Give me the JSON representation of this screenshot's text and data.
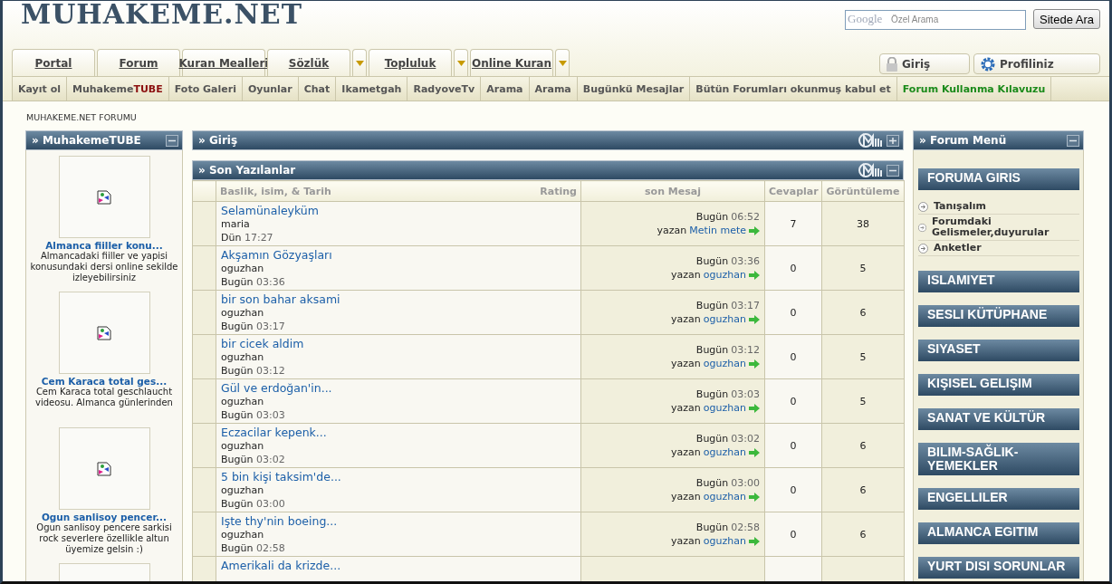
{
  "logo": {
    "text": "MUHAKEME.NET"
  },
  "search": {
    "brand": "Google",
    "placeholder": "Özel Arama",
    "button": "Sitede Ara"
  },
  "tabs": [
    {
      "label": "Portal",
      "dropdown": false
    },
    {
      "label": "Forum",
      "dropdown": false
    },
    {
      "label": "Kuran Mealleri",
      "dropdown": false
    },
    {
      "label": "Sözlük",
      "dropdown": true
    },
    {
      "label": "Topluluk",
      "dropdown": true
    },
    {
      "label": "Online Kuran",
      "dropdown": true
    }
  ],
  "user_buttons": [
    {
      "label": "Giriş"
    },
    {
      "label": "Profiliniz"
    }
  ],
  "subnav": [
    {
      "label": "Kayıt ol",
      "kind": "plain"
    },
    {
      "label": "Muhakeme",
      "accent": "TUBE",
      "kind": "accent"
    },
    {
      "label": "Foto Galeri",
      "kind": "plain"
    },
    {
      "label": "Oyunlar",
      "kind": "plain"
    },
    {
      "label": "Chat",
      "kind": "plain"
    },
    {
      "label": "Ikametgah",
      "kind": "plain"
    },
    {
      "label": "RadyoveTv",
      "kind": "plain"
    },
    {
      "label": "Arama",
      "kind": "plain"
    },
    {
      "label": "Arama",
      "kind": "plain"
    },
    {
      "label": "Bugünkü Mesajlar",
      "kind": "plain"
    },
    {
      "label": "Bütün Forumları okunmuş kabul et",
      "kind": "plain"
    },
    {
      "label": "Forum Kullanma Kılavuzu",
      "kind": "highlight"
    }
  ],
  "breadcrumb": "MUHAKEME.NET FORUMU",
  "tube": {
    "title": "» MuhakemeTUBE",
    "collapsed": false,
    "videos": [
      {
        "kind": "video",
        "title": "Almanca fiiller konu...",
        "description": "Almancadaki fiiller ve yapisi konusundaki dersi online sekilde izleyebilirsiniz"
      },
      {
        "kind": "video",
        "title": "Cem Karaca total ges...",
        "description": "Cem Karaca total geschlaucht videosu. Almanca günlerinden"
      },
      {
        "kind": "video",
        "title": "Ogun sanlisoy pencer...",
        "description": "Ogun sanlisoy pencere sarkisi rock severlere özellikle altun üyemize gelsin :)"
      },
      {
        "kind": "thumbnail"
      }
    ]
  },
  "login_panel": {
    "title": "» Giriş",
    "collapsed": true
  },
  "recent": {
    "title": "» Son Yazılanlar",
    "collapsed": false,
    "columns": {
      "topic": "Baslik, isim, & Tarih",
      "rating": "Rating",
      "last_post": "son Mesaj",
      "replies": "Cevaplar",
      "views": "Görüntüleme"
    },
    "rows": [
      {
        "title": "Selamünaleyküm",
        "author": "maria",
        "day": "Dün",
        "time": "17:27",
        "last_day": "Bugün",
        "last_time": "06:52",
        "by_label": "yazan",
        "last_by": "Metin mete",
        "replies": "7",
        "views": "38"
      },
      {
        "title": "Akşamın Gözyaşları",
        "author": "oguzhan",
        "day": "Bugün",
        "time": "03:36",
        "last_day": "Bugün",
        "last_time": "03:36",
        "by_label": "yazan",
        "last_by": "oguzhan",
        "replies": "0",
        "views": "5"
      },
      {
        "title": "bir son bahar aksami",
        "author": "oguzhan",
        "day": "Bugün",
        "time": "03:17",
        "last_day": "Bugün",
        "last_time": "03:17",
        "by_label": "yazan",
        "last_by": "oguzhan",
        "replies": "0",
        "views": "6"
      },
      {
        "title": "bir cicek aldim",
        "author": "oguzhan",
        "day": "Bugün",
        "time": "03:12",
        "last_day": "Bugün",
        "last_time": "03:12",
        "by_label": "yazan",
        "last_by": "oguzhan",
        "replies": "0",
        "views": "5"
      },
      {
        "title": "Gül ve erdoğan'in...",
        "author": "oguzhan",
        "day": "Bugün",
        "time": "03:03",
        "last_day": "Bugün",
        "last_time": "03:03",
        "by_label": "yazan",
        "last_by": "oguzhan",
        "replies": "0",
        "views": "5"
      },
      {
        "title": "Eczacilar kepenk...",
        "author": "oguzhan",
        "day": "Bugün",
        "time": "03:02",
        "last_day": "Bugün",
        "last_time": "03:02",
        "by_label": "yazan",
        "last_by": "oguzhan",
        "replies": "0",
        "views": "6"
      },
      {
        "title": "5 bin kişi taksim'de...",
        "author": "oguzhan",
        "day": "Bugün",
        "time": "03:00",
        "last_day": "Bugün",
        "last_time": "03:00",
        "by_label": "yazan",
        "last_by": "oguzhan",
        "replies": "0",
        "views": "6"
      },
      {
        "title": "Işte thy'nin boeing...",
        "author": "oguzhan",
        "day": "Bugün",
        "time": "02:58",
        "last_day": "Bugün",
        "last_time": "02:58",
        "by_label": "yazan",
        "last_by": "oguzhan",
        "replies": "0",
        "views": "6"
      },
      {
        "title": "Amerikali da krizde..."
      }
    ]
  },
  "forum_menu": {
    "title": "» Forum Menü",
    "collapsed": false,
    "sections": [
      {
        "label": "FORUMA GIRIS",
        "children": [
          {
            "label": "Tanışalım"
          },
          {
            "label": "Forumdaki Gelismeler,duyurular"
          },
          {
            "label": "Anketler"
          }
        ]
      },
      {
        "label": "ISLAMIYET"
      },
      {
        "label": "SESLI KÜTÜPHANE"
      },
      {
        "label": "SIYASET"
      },
      {
        "label": "KIŞISEL GELIŞIM"
      },
      {
        "label": "SANAT VE KÜLTÜR"
      },
      {
        "label": "BILIM-SAĞLIK-YEMEKLER"
      },
      {
        "label": "ENGELLILER"
      },
      {
        "label": "ALMANCA EGITIM"
      },
      {
        "label": "YURT DISI SORUNLAR"
      }
    ]
  }
}
